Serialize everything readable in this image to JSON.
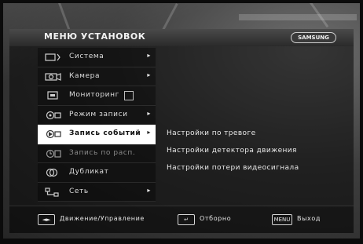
{
  "menu": {
    "title": "МЕНЮ УСТАНОВОК",
    "brand": "SAMSUNG",
    "items": [
      {
        "label": "Система",
        "arrow": "▸"
      },
      {
        "label": "Камера",
        "arrow": "▸"
      },
      {
        "label": "Мониторинг"
      },
      {
        "label": "Режим записи",
        "arrow": "▸"
      },
      {
        "label": "Запись событий",
        "arrow": "▸"
      },
      {
        "label": "Запись по расп."
      },
      {
        "label": "Дубликат"
      },
      {
        "label": "Сеть",
        "arrow": "▸"
      }
    ],
    "selected_index": 4
  },
  "submenu": {
    "items": [
      "Настройки по тревоге",
      "Настройки детектора движения",
      "Настройки потери видеосигнала"
    ]
  },
  "footer": {
    "move_key": "◄►",
    "move_label": "Движение/Управление",
    "enter_key": "↵",
    "enter_label": "Отборно",
    "menu_key": "MENU",
    "menu_label": "Выход"
  },
  "colors": {
    "selected_bg": "#ffffff",
    "menu_text": "#dcdcdc"
  }
}
